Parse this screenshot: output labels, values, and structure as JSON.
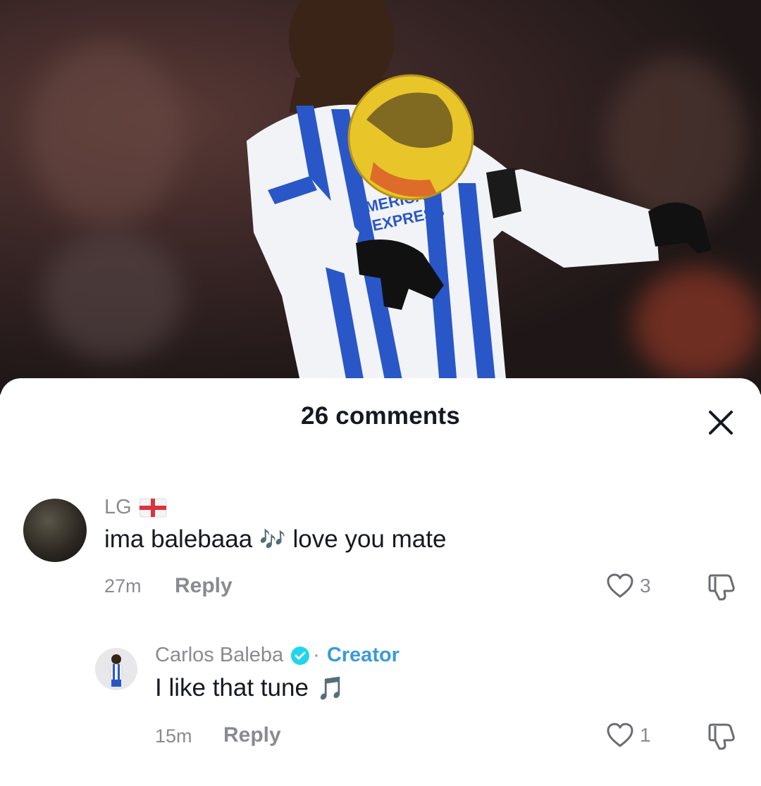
{
  "sheet": {
    "title": "26 comments"
  },
  "comments": [
    {
      "username": "LG",
      "flag": "england-flag-icon",
      "text": "ima balebaaa",
      "emoji": "🎶",
      "text_after": "love you mate",
      "time": "27m",
      "reply_label": "Reply",
      "likes": "3"
    }
  ],
  "reply": {
    "username": "Carlos Baleba",
    "badge": "verified-icon",
    "separator": "·",
    "creator_label": "Creator",
    "text": "I like that tune",
    "emoji": "🎵",
    "time": "15m",
    "reply_label": "Reply",
    "likes": "1"
  },
  "colors": {
    "accent_creator": "#3a9bd9",
    "muted": "#8a8b91",
    "text": "#161823"
  }
}
